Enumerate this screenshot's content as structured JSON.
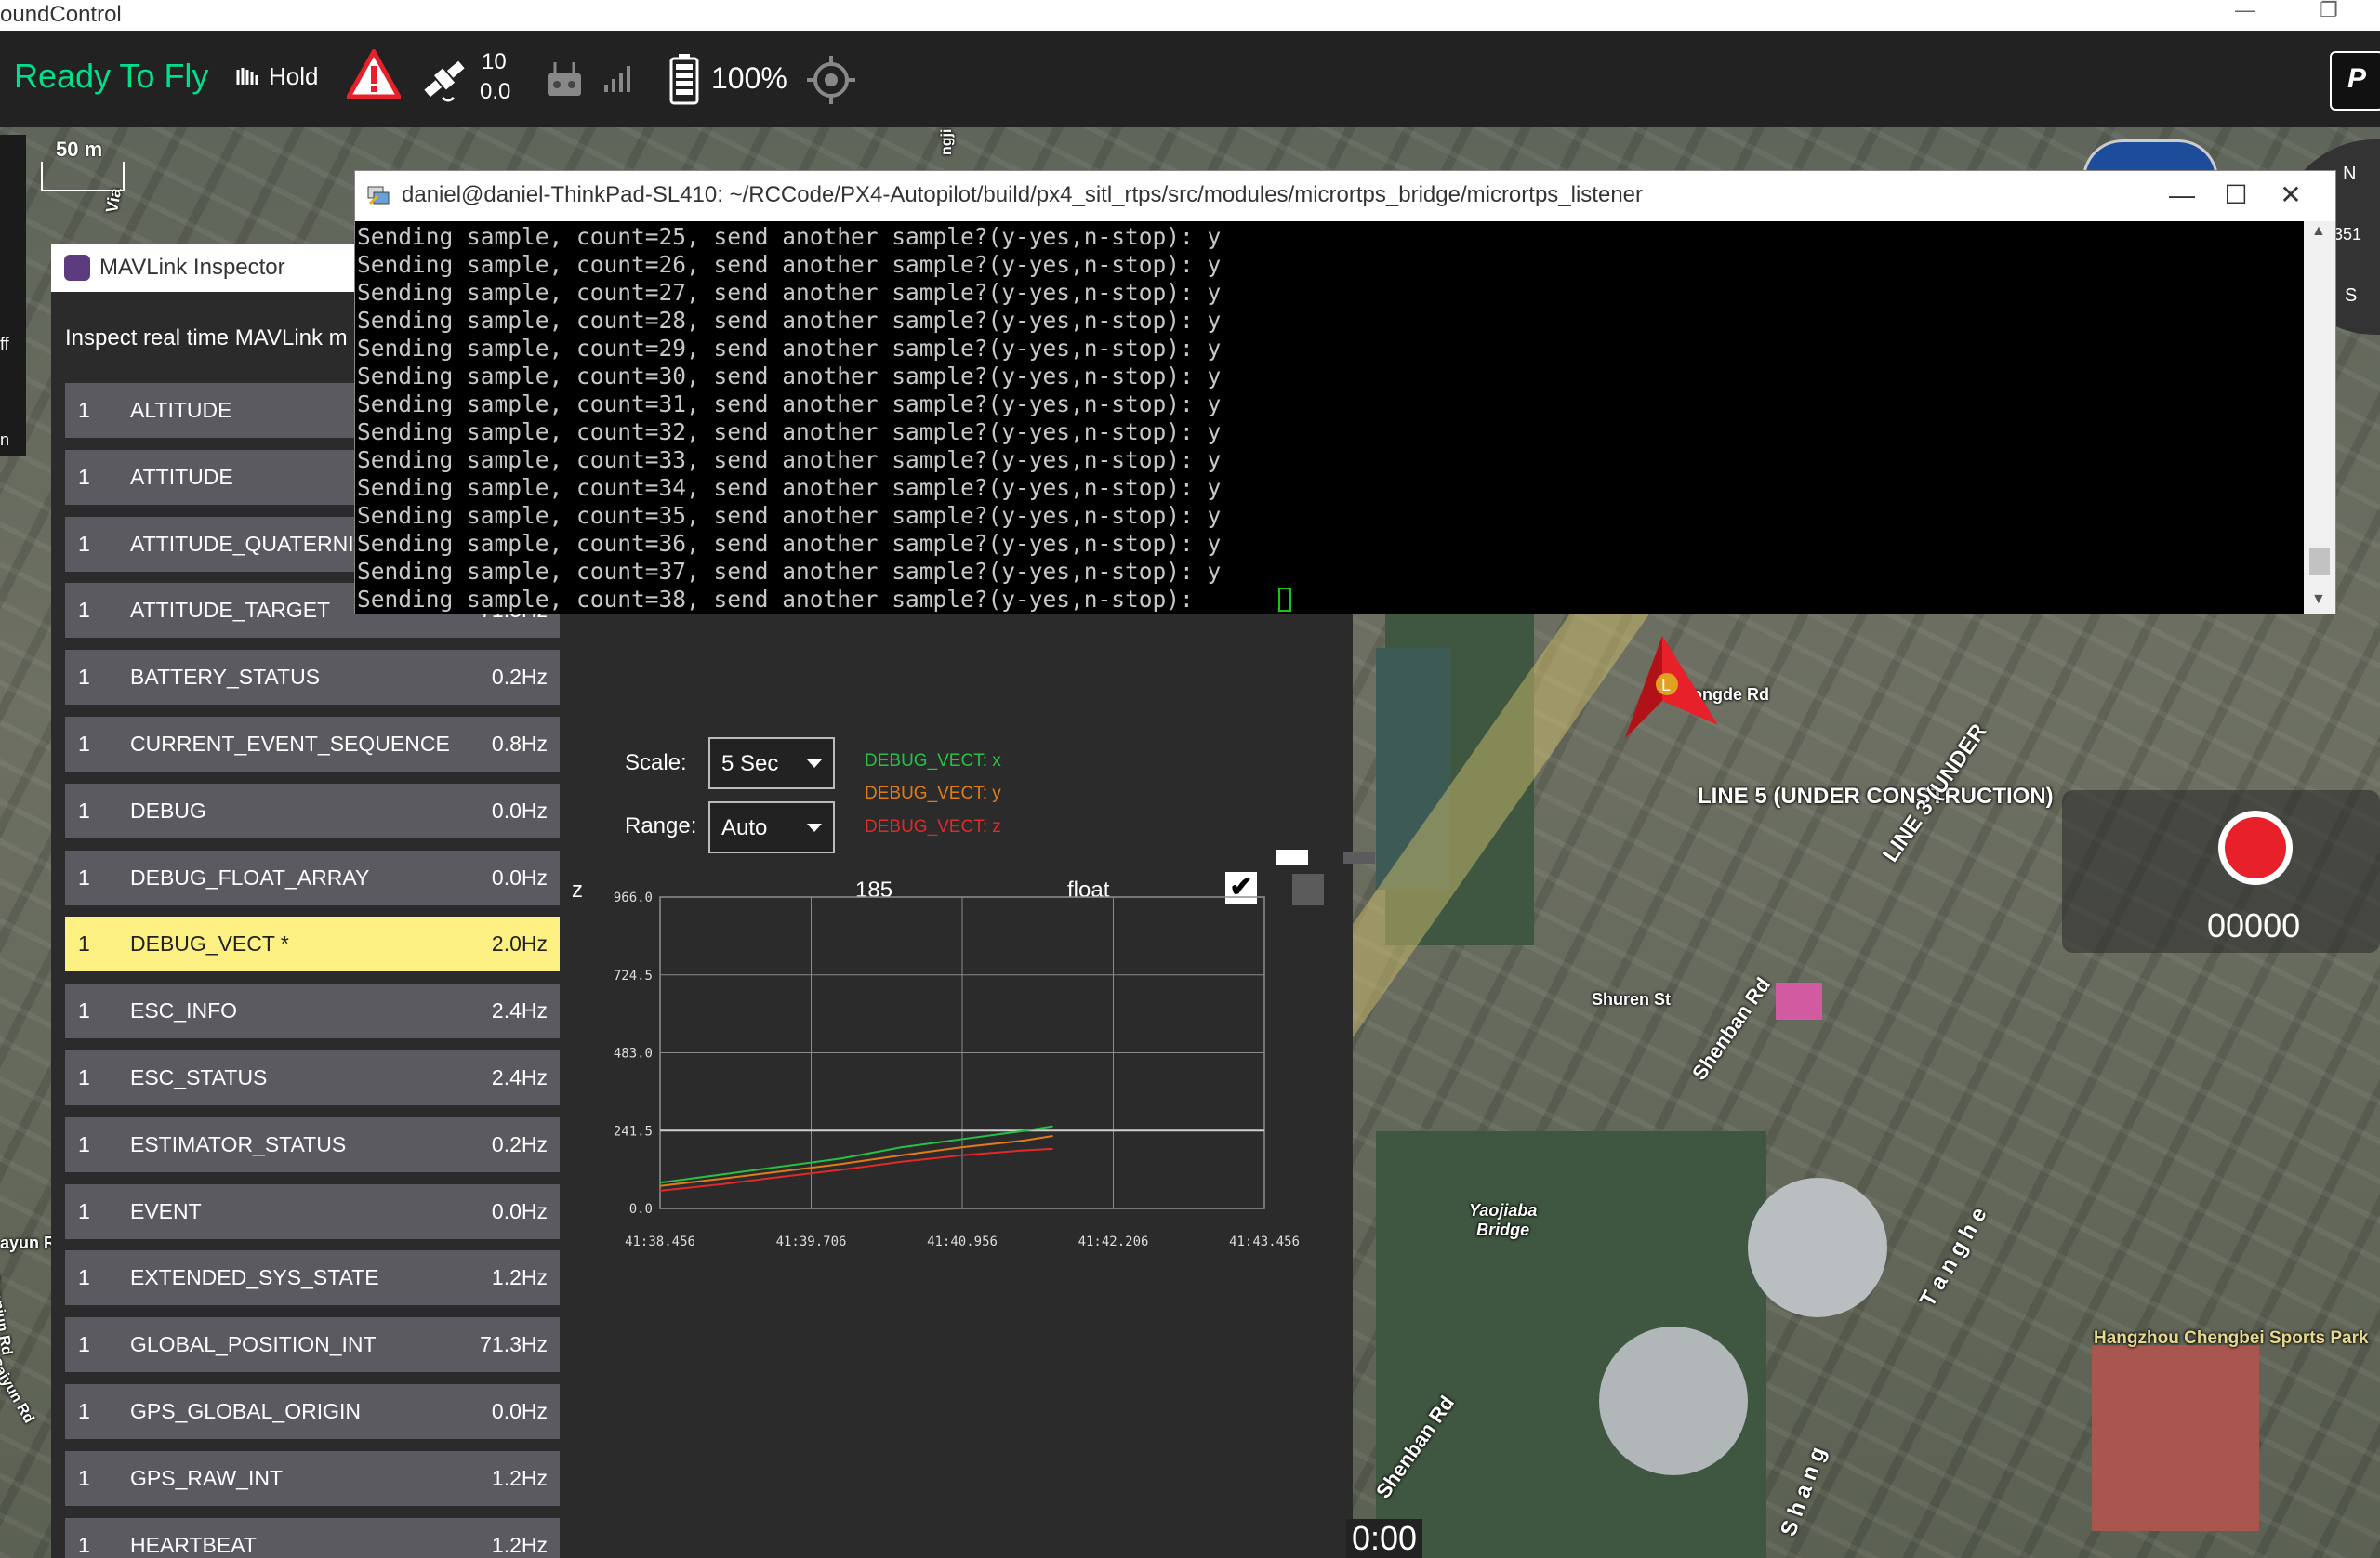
{
  "app": {
    "title": "oundControl",
    "window_controls": {
      "minimize": "—",
      "restore": "❐"
    }
  },
  "toolbar": {
    "flight_status": "Ready To Fly",
    "flight_mode": "Hold",
    "gps_satellites": "10",
    "gps_hdop": "0.0",
    "battery_percent": "100%",
    "icons": [
      "hold-icon",
      "warning-icon",
      "gps-satellite-icon",
      "rc-transmitter-icon",
      "signal-bars-icon",
      "battery-icon",
      "gimbal-target-icon",
      "brand-logo-icon"
    ],
    "colors": {
      "ready": "#00e08c",
      "warning": "#e8202a"
    }
  },
  "map": {
    "scale_text": "50 m",
    "labels": {
      "line5": "LINE 5 (UNDER CONSTRUCTION)",
      "line3": "LINE 3 (UNDER",
      "shenban_rd_1": "Shenban Rd",
      "shenban_rd_2": "Shenban Rd",
      "shuren_st": "Shuren St",
      "yaojiaba_bridge": "Yaojiaba\nBridge",
      "hangzhou_park": "Hangzhou Chengbei Sports Park",
      "longde_rd": "ongde Rd",
      "tangjiang": "T a n g h e",
      "shang": "S h a n g",
      "ayun": "ayun R",
      "caiyun": "Caiyun Rd",
      "guanjun": "Guanjun Rd",
      "vertical_via": "Via",
      "vertical_ngji": "ngji"
    },
    "compass": {
      "n": "N",
      "heading": "351",
      "s": "S"
    },
    "vehicle_marker": "L",
    "recording_counter": "00000",
    "timer": "0:00",
    "left_panel_fragments": {
      "f1": "ff",
      "f2": "n"
    }
  },
  "inspector": {
    "title": "MAVLink Inspector",
    "description": "Inspect real time MAVLink m",
    "messages": [
      {
        "comp": "1",
        "name": "ALTITUDE",
        "rate": ""
      },
      {
        "comp": "1",
        "name": "ATTITUDE",
        "rate": ""
      },
      {
        "comp": "1",
        "name": "ATTITUDE_QUATERNI",
        "rate": ""
      },
      {
        "comp": "1",
        "name": "ATTITUDE_TARGET",
        "rate": "71.3Hz"
      },
      {
        "comp": "1",
        "name": "BATTERY_STATUS",
        "rate": "0.2Hz"
      },
      {
        "comp": "1",
        "name": "CURRENT_EVENT_SEQUENCE",
        "rate": "0.8Hz"
      },
      {
        "comp": "1",
        "name": "DEBUG",
        "rate": "0.0Hz"
      },
      {
        "comp": "1",
        "name": "DEBUG_FLOAT_ARRAY",
        "rate": "0.0Hz"
      },
      {
        "comp": "1",
        "name": "DEBUG_VECT *",
        "rate": "2.0Hz",
        "selected": true
      },
      {
        "comp": "1",
        "name": "ESC_INFO",
        "rate": "2.4Hz"
      },
      {
        "comp": "1",
        "name": "ESC_STATUS",
        "rate": "2.4Hz"
      },
      {
        "comp": "1",
        "name": "ESTIMATOR_STATUS",
        "rate": "0.2Hz"
      },
      {
        "comp": "1",
        "name": "EVENT",
        "rate": "0.0Hz"
      },
      {
        "comp": "1",
        "name": "EXTENDED_SYS_STATE",
        "rate": "1.2Hz"
      },
      {
        "comp": "1",
        "name": "GLOBAL_POSITION_INT",
        "rate": "71.3Hz"
      },
      {
        "comp": "1",
        "name": "GPS_GLOBAL_ORIGIN",
        "rate": "0.0Hz"
      },
      {
        "comp": "1",
        "name": "GPS_RAW_INT",
        "rate": "1.2Hz"
      },
      {
        "comp": "1",
        "name": "HEARTBEAT",
        "rate": "1.2Hz"
      }
    ],
    "detail": {
      "field_name": "z",
      "field_value": "185",
      "field_type": "float",
      "plot_checked": "✔"
    },
    "scale_label": "Scale:",
    "scale_value": "5 Sec",
    "range_label": "Range:",
    "range_value": "Auto",
    "legend": {
      "x": "DEBUG_VECT: x",
      "y": "DEBUG_VECT: y",
      "z": "DEBUG_VECT: z"
    },
    "series_colors": {
      "x": "#27c046",
      "y": "#e07c16",
      "z": "#e02a2a"
    }
  },
  "terminal": {
    "title": "daniel@daniel-ThinkPad-SL410: ~/RCCode/PX4-Autopilot/build/px4_sitl_rtps/src/modules/micrortps_bridge/micrortps_listener",
    "controls": {
      "minimize": "—",
      "maximize": "☐",
      "close": "✕"
    },
    "lines": [
      "Sending sample, count=25, send another sample?(y-yes,n-stop): y",
      "Sending sample, count=26, send another sample?(y-yes,n-stop): y",
      "Sending sample, count=27, send another sample?(y-yes,n-stop): y",
      "Sending sample, count=28, send another sample?(y-yes,n-stop): y",
      "Sending sample, count=29, send another sample?(y-yes,n-stop): y",
      "Sending sample, count=30, send another sample?(y-yes,n-stop): y",
      "Sending sample, count=31, send another sample?(y-yes,n-stop): y",
      "Sending sample, count=32, send another sample?(y-yes,n-stop): y",
      "Sending sample, count=33, send another sample?(y-yes,n-stop): y",
      "Sending sample, count=34, send another sample?(y-yes,n-stop): y",
      "Sending sample, count=35, send another sample?(y-yes,n-stop): y",
      "Sending sample, count=36, send another sample?(y-yes,n-stop): y",
      "Sending sample, count=37, send another sample?(y-yes,n-stop): y",
      "Sending sample, count=38, send another sample?(y-yes,n-stop): "
    ],
    "scroll_up": "▲",
    "scroll_down": "▼"
  },
  "chart_data": {
    "type": "line",
    "title": "",
    "xlabel": "",
    "ylabel": "",
    "x_ticks": [
      "41:38.456",
      "41:39.706",
      "41:40.956",
      "41:42.206",
      "41:43.456"
    ],
    "y_ticks": [
      "0.0",
      "241.5",
      "483.0",
      "724.5",
      "966.0"
    ],
    "ylim": [
      0,
      966
    ],
    "xlim": [
      0,
      5
    ],
    "grid": true,
    "legend": "top-left (outside plot)",
    "series": [
      {
        "name": "DEBUG_VECT: x",
        "color": "#27c046",
        "x": [
          0,
          0.5,
          1.0,
          1.5,
          2.0,
          2.5,
          3.0,
          3.25
        ],
        "y": [
          80,
          105,
          130,
          155,
          190,
          215,
          240,
          255
        ]
      },
      {
        "name": "DEBUG_VECT: y",
        "color": "#e07c16",
        "x": [
          0,
          0.5,
          1.0,
          1.5,
          2.0,
          2.5,
          3.0,
          3.25
        ],
        "y": [
          70,
          92,
          115,
          138,
          165,
          190,
          210,
          225
        ]
      },
      {
        "name": "DEBUG_VECT: z",
        "color": "#e02a2a",
        "x": [
          0,
          0.5,
          1.0,
          1.5,
          2.0,
          2.5,
          3.0,
          3.25
        ],
        "y": [
          55,
          75,
          98,
          120,
          145,
          165,
          180,
          185
        ]
      }
    ],
    "reference_line": 241.5
  }
}
